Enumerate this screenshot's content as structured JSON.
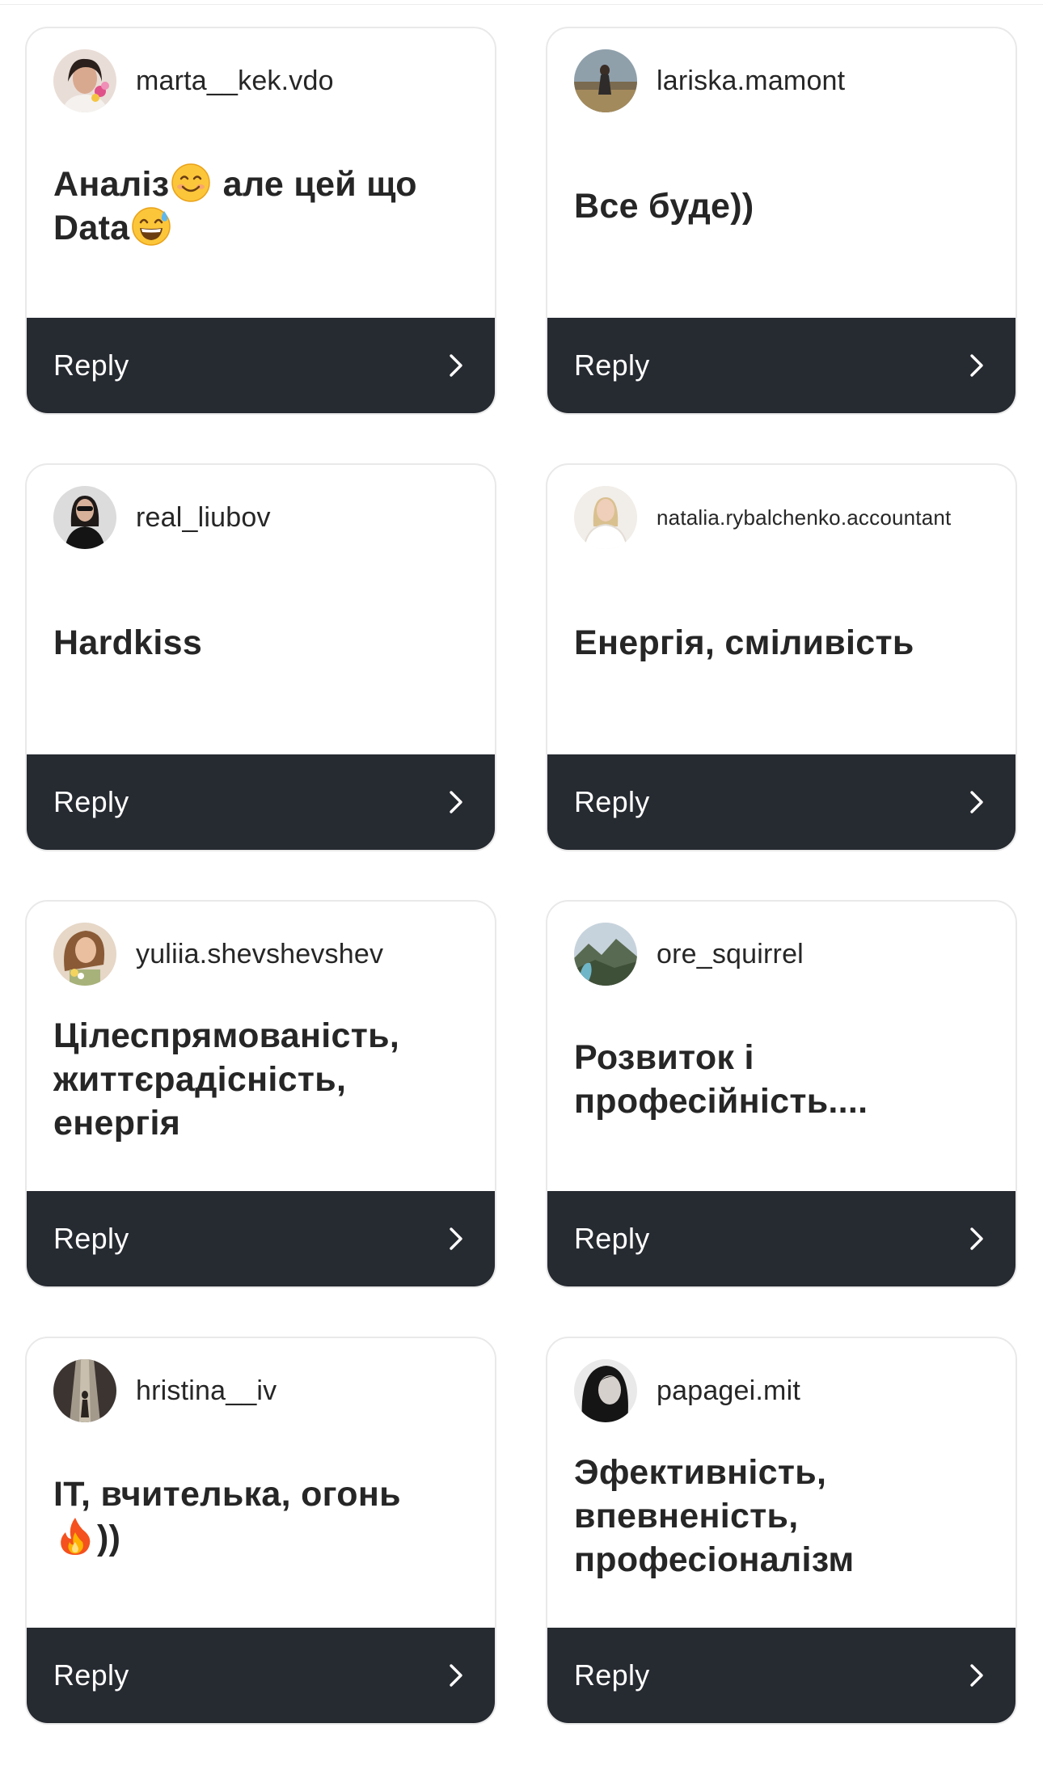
{
  "reply_label": "Reply",
  "cards": [
    {
      "username": "marta__kek.vdo",
      "message_before": "Аналіз",
      "message_middle": " але цей що Data",
      "emoji_1": "smiling-face-emoji",
      "emoji_2": "grinning-sweat-emoji"
    },
    {
      "username": "lariska.mamont",
      "message": "Все буде))"
    },
    {
      "username": "real_liubov",
      "message": "Hardkiss"
    },
    {
      "username": "natalia.rybalchenko.accountant",
      "message": "Енергія, сміливість"
    },
    {
      "username": "yuliia.shevshevshev",
      "message": "Цілеспрямованість, життєрадісність, енергія"
    },
    {
      "username": "ore_squirrel",
      "message": "Розвиток і професійність...."
    },
    {
      "username": "hristina__iv",
      "message_before": "IT, вчителька, огонь",
      "message_after": "))",
      "emoji_1": "fire-emoji"
    },
    {
      "username": "papagei.mit",
      "message": "Эфективність, впевненість, професіоналізм"
    }
  ],
  "colors": {
    "reply_bar": "#262a31",
    "text": "#262626",
    "card_border": "#e9e9e9"
  }
}
